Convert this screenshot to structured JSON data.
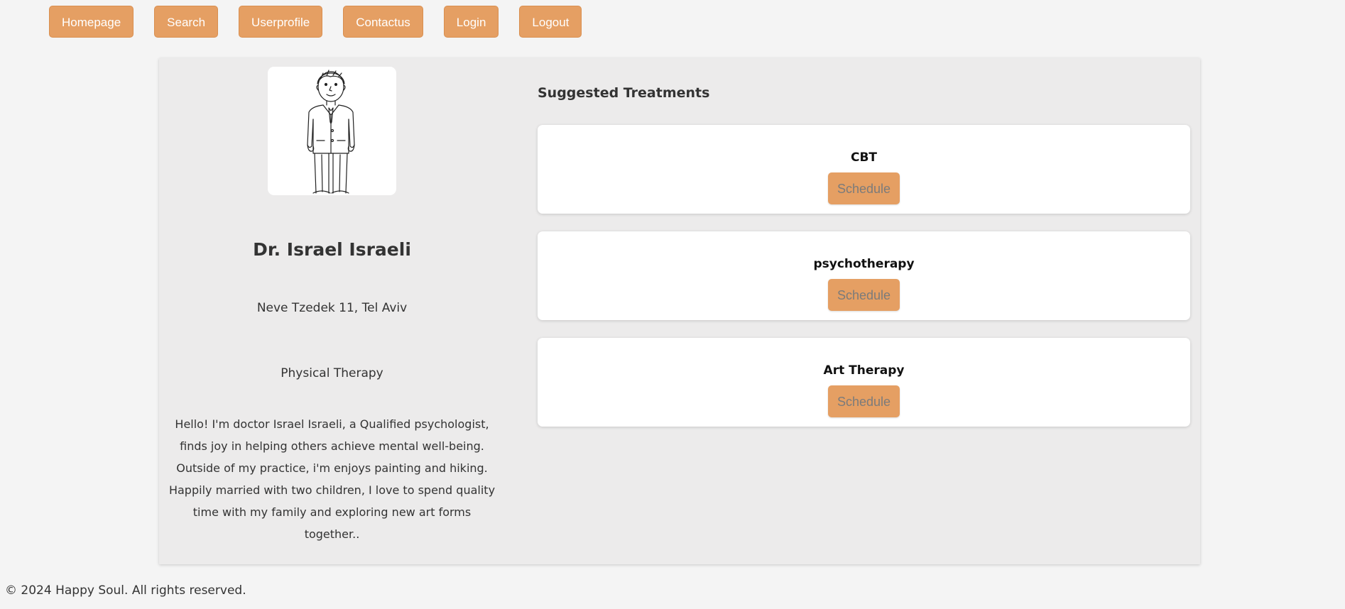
{
  "nav": {
    "items": [
      {
        "label": "Homepage"
      },
      {
        "label": "Search"
      },
      {
        "label": "Userprofile"
      },
      {
        "label": "Contactus"
      },
      {
        "label": "Login"
      },
      {
        "label": "Logout"
      }
    ]
  },
  "profile": {
    "avatar_icon": "doctor-illustration",
    "name": "Dr. Israel Israeli",
    "address": "Neve Tzedek 11, Tel Aviv",
    "specialty": "Physical Therapy",
    "bio": "Hello! I'm doctor Israel Israeli, a Qualified psychologist, finds joy in helping others achieve mental well-being. Outside of my practice, i'm enjoys painting and hiking. Happily married with two children, I love to spend quality time with my family and exploring new art forms together.."
  },
  "treatments": {
    "title": "Suggested Treatments",
    "items": [
      {
        "name": "CBT",
        "button_label": "Schedule"
      },
      {
        "name": "psychotherapy",
        "button_label": "Schedule"
      },
      {
        "name": "Art Therapy",
        "button_label": "Schedule"
      }
    ]
  },
  "footer": {
    "text": "© 2024 Happy Soul. All rights reserved."
  },
  "colors": {
    "accent": "#e59f63",
    "panel": "#ecebeb",
    "background": "#f4f4f4"
  }
}
